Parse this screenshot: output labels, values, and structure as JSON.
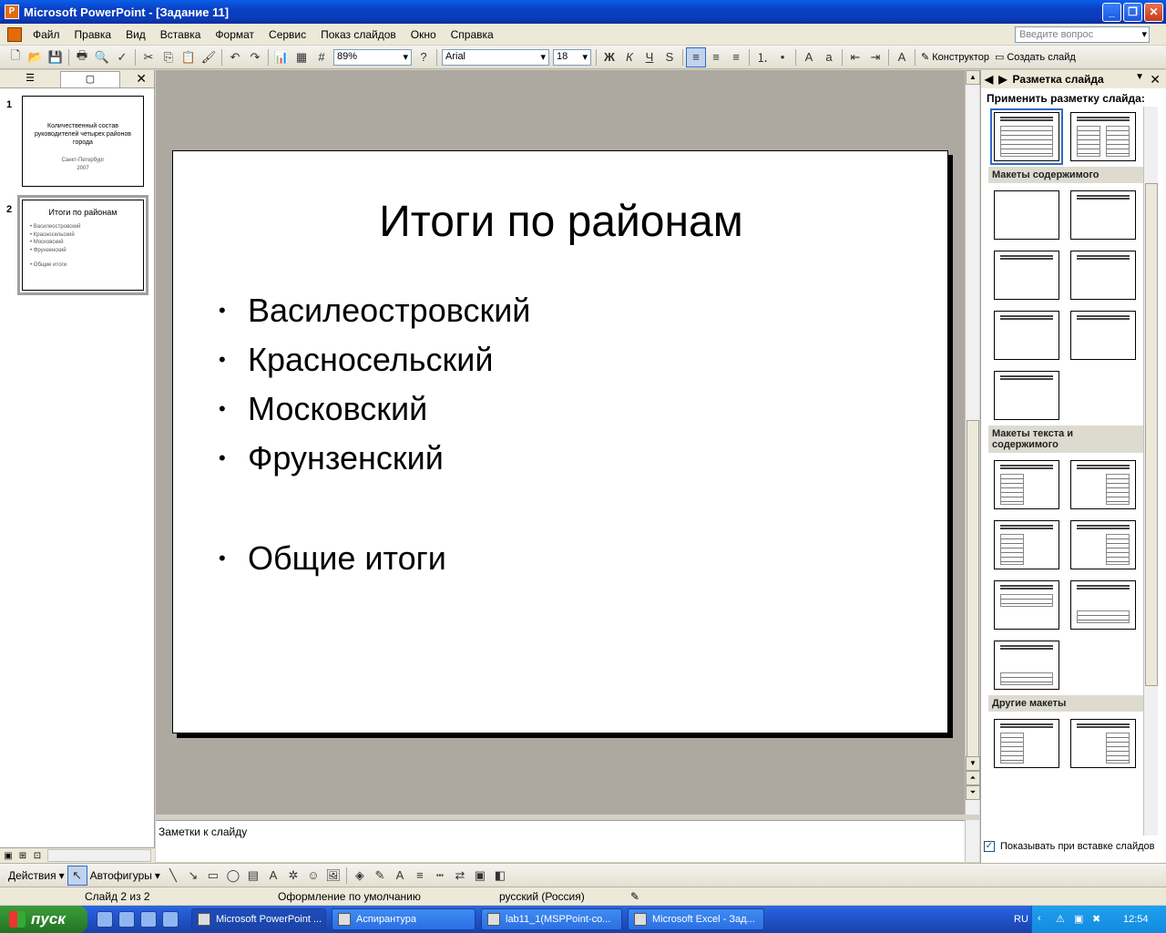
{
  "window": {
    "title": "Microsoft PowerPoint - [Задание 11]"
  },
  "menu": {
    "items": [
      "Файл",
      "Правка",
      "Вид",
      "Вставка",
      "Формат",
      "Сервис",
      "Показ слайдов",
      "Окно",
      "Справка"
    ],
    "help_placeholder": "Введите вопрос"
  },
  "toolbar": {
    "zoom": "89%",
    "font": "Arial",
    "font_size": "18",
    "bold": "Ж",
    "italic": "К",
    "underline": "Ч",
    "shadow": "S",
    "designer": "Конструктор",
    "new_slide": "Создать слайд"
  },
  "slides": [
    {
      "num": "1",
      "title": "Количественный состав руководителей четырех районов города",
      "subtitle": "Санкт-Петербург",
      "year": "2007"
    },
    {
      "num": "2",
      "title": "Итоги по районам",
      "bullets": [
        "Василеостровский",
        "Красносельский",
        "Московский",
        "Фрунзенский",
        "Общие итоги"
      ]
    }
  ],
  "current_slide": {
    "title": "Итоги по районам",
    "bullets": [
      "Василеостровский",
      "Красносельский",
      "Московский",
      "Фрунзенский"
    ],
    "bullet_after_gap": "Общие итоги"
  },
  "notes": {
    "placeholder": "Заметки к слайду"
  },
  "task_pane": {
    "title": "Разметка слайда",
    "apply_label": "Применить разметку слайда:",
    "section_content": "Макеты содержимого",
    "section_text_content": "Макеты текста и содержимого",
    "section_other": "Другие макеты",
    "show_on_insert": "Показывать при вставке слайдов"
  },
  "drawbar": {
    "actions": "Действия",
    "autoshapes": "Автофигуры"
  },
  "status": {
    "slide": "Слайд 2 из 2",
    "design": "Оформление по умолчанию",
    "language": "русский (Россия)"
  },
  "taskbar": {
    "start": "пуск",
    "tasks": [
      "Microsoft PowerPoint ...",
      "Аспирантура",
      "lab11_1(MSPPoint-co...",
      "Microsoft Excel - Зад..."
    ],
    "lang": "RU",
    "clock": "12:54"
  }
}
